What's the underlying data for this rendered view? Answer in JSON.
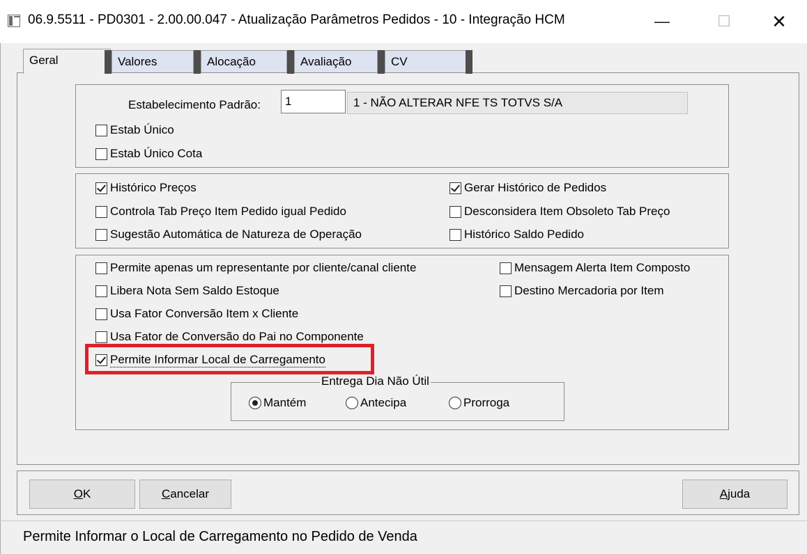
{
  "window": {
    "title": "06.9.5511 - PD0301 - 2.00.00.047 - Atualização Parâmetros Pedidos - 10 - Integração HCM",
    "min_glyph": "—",
    "max_glyph": "☐",
    "close_glyph": "✕"
  },
  "tabs": [
    {
      "label": "Geral"
    },
    {
      "label": "Valores"
    },
    {
      "label": "Alocação"
    },
    {
      "label": "Avaliação"
    },
    {
      "label": "CV"
    }
  ],
  "estab": {
    "label": "Estabelecimento Padrão:",
    "value": "1",
    "description": "1 - NÃO ALTERAR NFE TS TOTVS S/A"
  },
  "group1": {
    "estab_unico": {
      "label": "Estab Único",
      "checked": false
    },
    "estab_unico_cota": {
      "label": "Estab Único Cota",
      "checked": false
    }
  },
  "group2": {
    "historico_precos": {
      "label": "Histórico Preços",
      "checked": true
    },
    "controla_tab": {
      "label": "Controla Tab Preço Item Pedido igual Pedido",
      "checked": false
    },
    "sugestao": {
      "label": "Sugestão Automática de Natureza de Operação",
      "checked": false
    },
    "gerar_historico": {
      "label": "Gerar Histórico de Pedidos",
      "checked": true
    },
    "desconsidera": {
      "label": "Desconsidera Item Obsoleto Tab Preço",
      "checked": false
    },
    "historico_saldo": {
      "label": "Histórico Saldo Pedido",
      "checked": false
    }
  },
  "group3": {
    "permite_representante": {
      "label": "Permite apenas um representante por cliente/canal cliente",
      "checked": false
    },
    "libera_nota": {
      "label": "Libera Nota Sem Saldo Estoque",
      "checked": false
    },
    "usa_fator": {
      "label": "Usa Fator Conversão Item x Cliente",
      "checked": false
    },
    "usa_fator_pai": {
      "label": "Usa Fator de Conversão do Pai no Componente",
      "checked": false
    },
    "permite_local": {
      "label": "Permite Informar Local de Carregamento",
      "checked": true
    },
    "mensagem_alerta": {
      "label": "Mensagem Alerta Item Composto",
      "checked": false
    },
    "destino_mercadoria": {
      "label": "Destino Mercadoria por Item",
      "checked": false
    }
  },
  "entrega": {
    "legend": "Entrega Dia Não Útil",
    "options": [
      {
        "label": "Mantém",
        "checked": true
      },
      {
        "label": "Antecipa",
        "checked": false
      },
      {
        "label": "Prorroga",
        "checked": false
      }
    ]
  },
  "buttons": {
    "ok_first": "O",
    "ok_rest": "K",
    "cancel_first": "C",
    "cancel_rest": "ancelar",
    "help_first": "A",
    "help_rest": "juda"
  },
  "status": {
    "text": "Permite Informar o Local de Carregamento no Pedido de Venda"
  }
}
